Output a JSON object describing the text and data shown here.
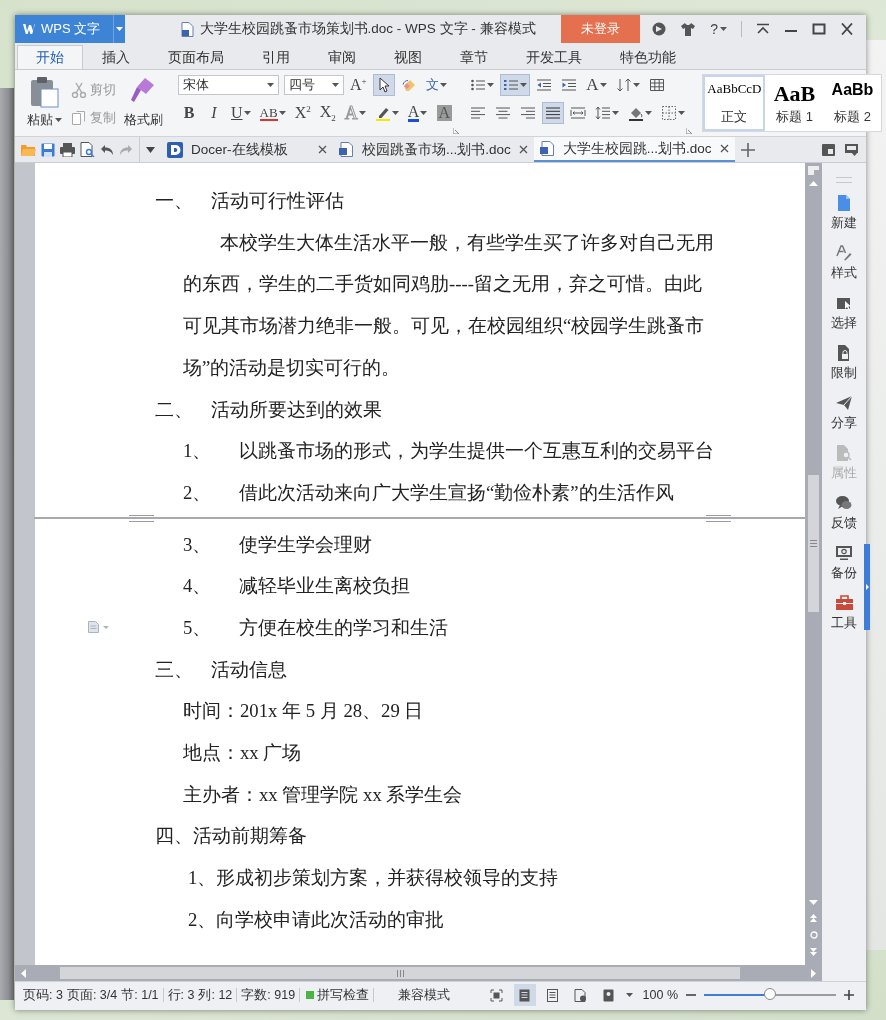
{
  "window": {
    "app_name": "WPS 文字",
    "title": "大学生校园跳蚤市场策划书.doc - WPS 文字 - 兼容模式",
    "login": "未登录",
    "help": "?"
  },
  "ribbon_tabs": [
    {
      "label": "开始",
      "selected": true
    },
    {
      "label": "插入",
      "selected": false
    },
    {
      "label": "页面布局",
      "selected": false
    },
    {
      "label": "引用",
      "selected": false
    },
    {
      "label": "审阅",
      "selected": false
    },
    {
      "label": "视图",
      "selected": false
    },
    {
      "label": "章节",
      "selected": false
    },
    {
      "label": "开发工具",
      "selected": false
    },
    {
      "label": "特色功能",
      "selected": false
    }
  ],
  "ribbon": {
    "clipboard": [
      {
        "kind": "paste",
        "label": "粘贴",
        "disabled": false
      },
      {
        "kind": "cut",
        "label": "剪切",
        "disabled": true
      },
      {
        "kind": "copy",
        "label": "复制",
        "disabled": true
      },
      {
        "kind": "painter",
        "label": "格式刷",
        "disabled": false
      }
    ],
    "font_name": "宋体",
    "font_size": "四号",
    "font_tools": [
      {
        "kind": "grow",
        "glyph": "A$^{+}$",
        "selected": false
      },
      {
        "kind": "select",
        "selected": true
      },
      {
        "kind": "clear",
        "selected": false
      },
      {
        "kind": "phonetic",
        "glyph": "文",
        "selected": false
      }
    ],
    "font_format": [
      {
        "kind": "bold",
        "glyph": "B"
      },
      {
        "kind": "italic",
        "glyph": "I"
      },
      {
        "kind": "underline",
        "glyph": "U"
      },
      {
        "kind": "strike",
        "glyph": "AB"
      },
      {
        "kind": "superscript",
        "glyph": "X$^{2}$"
      },
      {
        "kind": "subscript",
        "glyph": "X$_{2}$"
      },
      {
        "kind": "effect",
        "glyph": "A"
      },
      {
        "kind": "highlight"
      },
      {
        "kind": "color",
        "glyph": "A"
      },
      {
        "kind": "shade",
        "glyph": "A"
      }
    ],
    "paragraph_row1": [
      {
        "kind": "bullets",
        "selected": false
      },
      {
        "kind": "numbering",
        "selected": true
      },
      {
        "kind": "outdent",
        "selected": false
      },
      {
        "kind": "indent",
        "selected": false
      },
      {
        "kind": "case",
        "glyph": "A",
        "selected": false
      },
      {
        "kind": "sort",
        "selected": false
      },
      {
        "kind": "table",
        "selected": false
      }
    ],
    "paragraph_row2": [
      {
        "kind": "left",
        "selected": false
      },
      {
        "kind": "center",
        "selected": false
      },
      {
        "kind": "right",
        "selected": false
      },
      {
        "kind": "justify",
        "selected": true
      },
      {
        "kind": "distributed",
        "selected": false
      },
      {
        "kind": "spacing",
        "selected": false
      },
      {
        "kind": "fill",
        "selected": false
      },
      {
        "kind": "border",
        "selected": false
      }
    ],
    "styles": [
      {
        "preview": "AaBbCcD",
        "label": "正文",
        "selected": true
      },
      {
        "preview": "AaB",
        "label": "标题 1",
        "selected": false
      },
      {
        "preview": "AaBb",
        "label": "标题 2",
        "selected": false
      }
    ]
  },
  "doc_tabs": [
    {
      "kind": "docer",
      "label": "Docer-在线模板",
      "selected": false
    },
    {
      "kind": "doc",
      "label": "校园跳蚤市场...划书.doc",
      "selected": false
    },
    {
      "kind": "doc",
      "label": "大学生校园跳...划书.doc",
      "selected": true
    }
  ],
  "document": {
    "blocks": [
      {
        "kind": "heading",
        "number": "一、",
        "text": "活动可行性评估"
      },
      {
        "kind": "paragraph",
        "lines": [
          "本校学生大体生活水平一般，有些学生买了许多对自己无用",
          "的东西，学生的二手货如同鸡肋----留之无用，弃之可惜。由此",
          "可见其市场潜力绝非一般。可见，在校园组织“校园学生跳蚤市",
          "场”的活动是切实可行的。"
        ]
      },
      {
        "kind": "heading",
        "number": "二、",
        "text": "活动所要达到的效果"
      },
      {
        "kind": "item",
        "number": "1、",
        "text": "以跳蚤市场的形式，为学生提供一个互惠互利的交易平台"
      },
      {
        "kind": "item",
        "number": "2、",
        "text": "借此次活动来向广大学生宣扬“勤俭朴素”的生活作风"
      },
      {
        "kind": "page_break"
      },
      {
        "kind": "item",
        "number": "3、",
        "text": "使学生学会理财"
      },
      {
        "kind": "item",
        "number": "4、",
        "text": "减轻毕业生离校负担"
      },
      {
        "kind": "item",
        "number": "5、",
        "text": "方便在校生的学习和生活",
        "margin_icon": true
      },
      {
        "kind": "heading",
        "number": "三、",
        "text": "活动信息"
      },
      {
        "kind": "line",
        "text": "时间：201x 年 5 月 28、29 日"
      },
      {
        "kind": "line",
        "text": "地点：xx 广场"
      },
      {
        "kind": "line",
        "text": "主办者：xx 管理学院 xx 系学生会"
      },
      {
        "kind": "title",
        "text": "四、活动前期筹备"
      },
      {
        "kind": "subitem",
        "text": "1、形成初步策划方案，并获得校领导的支持"
      },
      {
        "kind": "subitem",
        "text": "2、向学校申请此次活动的审批"
      }
    ]
  },
  "side_panel": [
    {
      "kind": "new",
      "label": "新建",
      "disabled": false
    },
    {
      "kind": "style",
      "label": "样式",
      "disabled": false
    },
    {
      "kind": "select",
      "label": "选择",
      "disabled": false
    },
    {
      "kind": "restrict",
      "label": "限制",
      "disabled": false
    },
    {
      "kind": "share",
      "label": "分享",
      "disabled": false
    },
    {
      "kind": "properties",
      "label": "属性",
      "disabled": true
    },
    {
      "kind": "feedback",
      "label": "反馈",
      "disabled": false
    },
    {
      "kind": "backup",
      "label": "备份",
      "disabled": false
    },
    {
      "kind": "tools",
      "label": "工具",
      "disabled": false
    }
  ],
  "status_bar": {
    "fields": [
      "页码: 3",
      "页面: 3/4",
      "节: 1/1",
      "行: 3",
      "列: 12",
      "字数: 919"
    ],
    "spell_check": "拼写检查",
    "mode": "兼容模式",
    "views": [
      {
        "kind": "fullscreen",
        "selected": false
      },
      {
        "kind": "page",
        "selected": true
      },
      {
        "kind": "outline",
        "selected": false
      },
      {
        "kind": "web",
        "selected": false
      },
      {
        "kind": "reading",
        "selected": false
      }
    ],
    "zoom": "100 %",
    "zoom_slider": {
      "level": 0.5
    }
  }
}
